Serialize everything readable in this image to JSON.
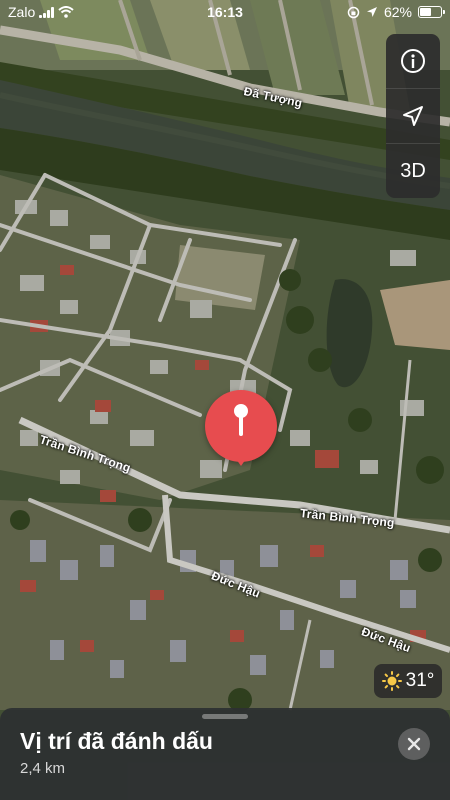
{
  "status_bar": {
    "carrier": "Zalo",
    "time": "16:13",
    "battery_percent": "62%",
    "battery_level": 0.62,
    "icons": [
      "signal-icon",
      "wifi-icon",
      "rotation-lock-icon",
      "location-arrow-icon",
      "battery-icon"
    ]
  },
  "map": {
    "style": "satellite",
    "road_labels": [
      "Đã Tượng",
      "Trần Bình Trọng",
      "Trần Bình Trọng",
      "Đức Hậu",
      "Đức Hậu"
    ],
    "pin_color": "#e74c4f"
  },
  "controls": {
    "info_icon": "info-icon",
    "location_icon": "location-arrow-icon",
    "button_3d": "3D"
  },
  "weather": {
    "icon": "sun-icon",
    "temperature": "31°"
  },
  "place_sheet": {
    "title": "Vị trí đã đánh dấu",
    "distance": "2,4 km",
    "close_icon": "close-icon"
  }
}
